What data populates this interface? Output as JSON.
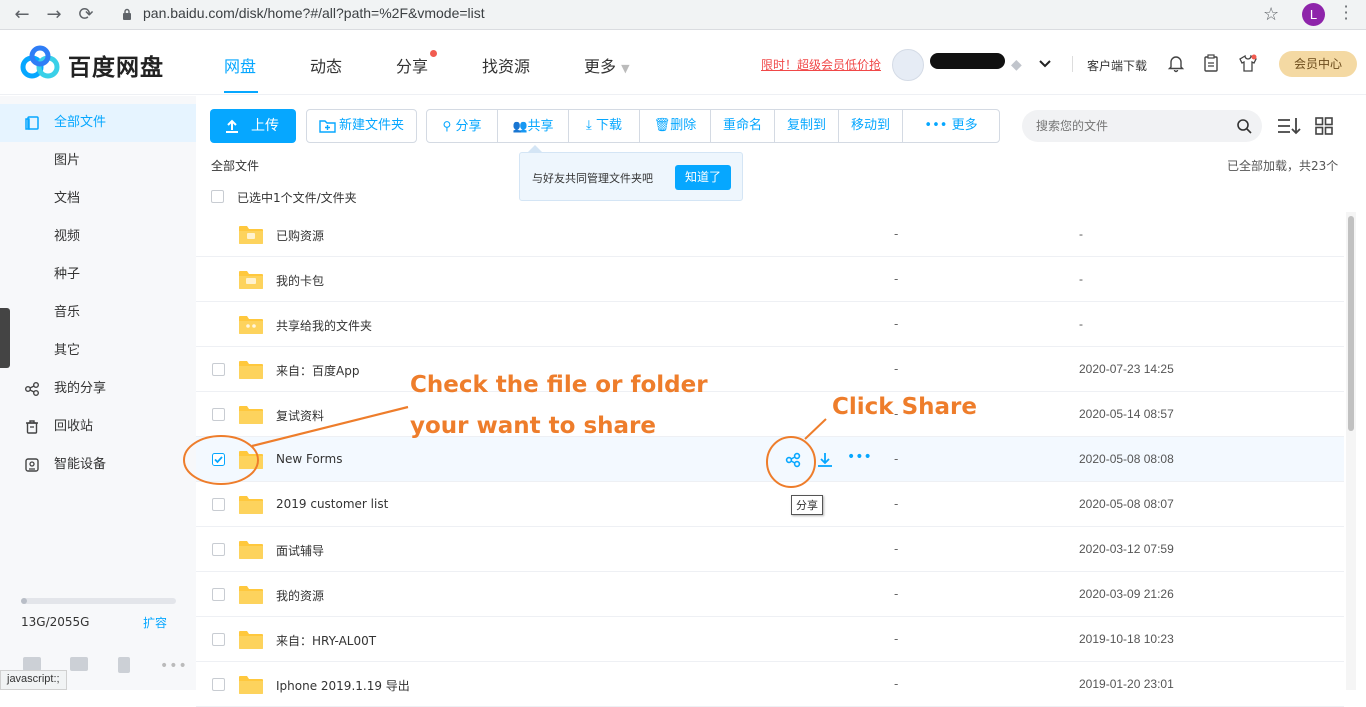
{
  "browser": {
    "url": "pan.baidu.com/disk/home?#/all?path=%2F&vmode=list",
    "profile_initial": "L"
  },
  "header": {
    "logo_text": "百度网盘",
    "nav": [
      "网盘",
      "动态",
      "分享",
      "找资源",
      "更多"
    ],
    "promo": "限时！超级会员低价抢",
    "client_download": "客户端下载",
    "vip_center": "会员中心",
    "brand_color": "#06a7ff"
  },
  "sidebar": {
    "items": [
      {
        "label": "全部文件",
        "icon": "files-icon"
      },
      {
        "label": "图片"
      },
      {
        "label": "文档"
      },
      {
        "label": "视频"
      },
      {
        "label": "种子"
      },
      {
        "label": "音乐"
      },
      {
        "label": "其它"
      },
      {
        "label": "我的分享",
        "icon": "share-icon"
      },
      {
        "label": "回收站",
        "icon": "trash-icon"
      },
      {
        "label": "智能设备",
        "icon": "device-icon"
      }
    ],
    "quota": "13G/2055G",
    "quota_used_fraction": 0.0063,
    "expand": "扩容"
  },
  "toolbar": {
    "upload": "上传",
    "new_folder": "新建文件夹",
    "actions": [
      "分享",
      "共享",
      "下载",
      "删除",
      "重命名",
      "复制到",
      "移动到",
      "更多"
    ],
    "search_placeholder": "搜索您的文件"
  },
  "breadcrumb": "全部文件",
  "load_status": "已全部加载，共23个",
  "selection_text": "已选中1个文件/文件夹",
  "tooltip": {
    "text": "与好友共同管理文件夹吧",
    "button": "知道了"
  },
  "files": [
    {
      "name": "已购资源",
      "size": "-",
      "date": "-",
      "checkbox": false,
      "folder_type": "purchased"
    },
    {
      "name": "我的卡包",
      "size": "-",
      "date": "-",
      "checkbox": false,
      "folder_type": "card"
    },
    {
      "name": "共享给我的文件夹",
      "size": "-",
      "date": "-",
      "checkbox": false,
      "folder_type": "shared"
    },
    {
      "name": "来自：百度App",
      "size": "-",
      "date": "2020-07-23 14:25",
      "checkbox": true,
      "checked": false
    },
    {
      "name": "复试资料",
      "size": "-",
      "date": "2020-05-14 08:57",
      "checkbox": true,
      "checked": false
    },
    {
      "name": "New Forms",
      "size": "-",
      "date": "2020-05-08 08:08",
      "checkbox": true,
      "checked": true
    },
    {
      "name": "2019 customer list",
      "size": "-",
      "date": "2020-05-08 08:07",
      "checkbox": true,
      "checked": false
    },
    {
      "name": "面试辅导",
      "size": "-",
      "date": "2020-03-12 07:59",
      "checkbox": true,
      "checked": false
    },
    {
      "name": "我的资源",
      "size": "-",
      "date": "2020-03-09 21:26",
      "checkbox": true,
      "checked": false
    },
    {
      "name": "来自：HRY-AL00T",
      "size": "-",
      "date": "2019-10-18 10:23",
      "checkbox": true,
      "checked": false
    },
    {
      "name": "Iphone 2019.1.19 导出",
      "size": "-",
      "date": "2019-01-20 23:01",
      "checkbox": true,
      "checked": false
    }
  ],
  "row_share_tooltip": "分享",
  "annotations": {
    "check_line1": "Check the file or folder",
    "check_line2": "your want to share",
    "click_share": "Click Share",
    "annotation_color": "#ee7d2b"
  },
  "status_bar": "javascript:;"
}
